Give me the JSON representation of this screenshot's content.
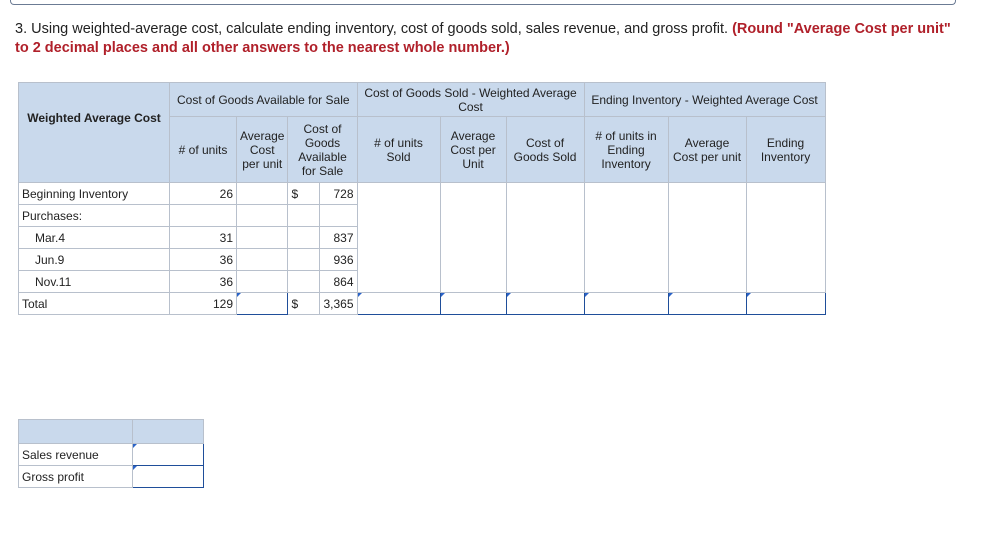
{
  "question": {
    "text": "3. Using weighted-average cost, calculate ending inventory, cost of goods sold, sales revenue, and gross profit.",
    "instruction": "(Round \"Average Cost per unit\" to 2 decimal places and all other answers to the nearest whole number.)"
  },
  "headers": {
    "row_label": "Weighted Average Cost",
    "group_available": "Cost of Goods Available for Sale",
    "group_sold": "Cost of Goods Sold - Weighted Average Cost",
    "group_ending": "Ending Inventory - Weighted Average Cost",
    "units": "# of units",
    "avg_cost": "Average Cost per unit",
    "cost_available": "Cost of Goods Available for Sale",
    "units_sold": "# of units Sold",
    "avg_cost_sold": "Average Cost per Unit",
    "cogs": "Cost of Goods Sold",
    "units_ending": "# of units in Ending Inventory",
    "avg_cost_ending": "Average Cost per unit",
    "ending_inventory": "Ending Inventory"
  },
  "rows": [
    {
      "label": "Beginning Inventory",
      "units": "26",
      "dollar": "$",
      "cost": "728"
    },
    {
      "label": "Purchases:",
      "units": "",
      "dollar": "",
      "cost": ""
    },
    {
      "label": "Mar.4",
      "units": "31",
      "dollar": "",
      "cost": "837"
    },
    {
      "label": "Jun.9",
      "units": "36",
      "dollar": "",
      "cost": "936"
    },
    {
      "label": "Nov.11",
      "units": "36",
      "dollar": "",
      "cost": "864"
    },
    {
      "label": "Total",
      "units": "129",
      "dollar": "$",
      "cost": "3,365"
    }
  ],
  "summary": {
    "sales_revenue": "Sales revenue",
    "gross_profit": "Gross profit"
  }
}
